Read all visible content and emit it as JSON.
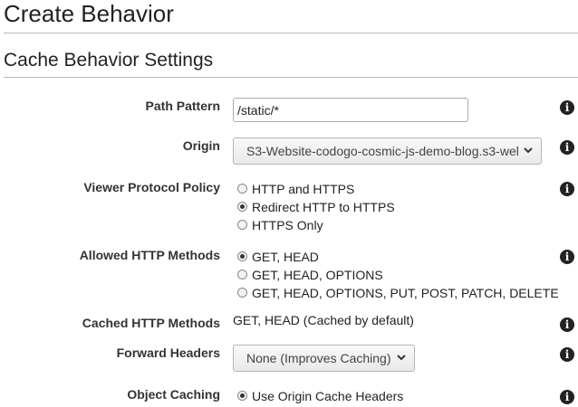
{
  "page_title": "Create Behavior",
  "section_title": "Cache Behavior Settings",
  "fields": {
    "path_pattern": {
      "label": "Path Pattern",
      "value": "/static/*"
    },
    "origin": {
      "label": "Origin",
      "value": "S3-Website-codogo-cosmic-js-demo-blog.s3-wel"
    },
    "viewer_protocol_policy": {
      "label": "Viewer Protocol Policy",
      "options": [
        "HTTP and HTTPS",
        "Redirect HTTP to HTTPS",
        "HTTPS Only"
      ],
      "selected": "Redirect HTTP to HTTPS"
    },
    "allowed_http_methods": {
      "label": "Allowed HTTP Methods",
      "options": [
        "GET, HEAD",
        "GET, HEAD, OPTIONS",
        "GET, HEAD, OPTIONS, PUT, POST, PATCH, DELETE"
      ],
      "selected": "GET, HEAD"
    },
    "cached_http_methods": {
      "label": "Cached HTTP Methods",
      "value": "GET, HEAD (Cached by default)"
    },
    "forward_headers": {
      "label": "Forward Headers",
      "value": "None (Improves Caching)"
    },
    "object_caching": {
      "label": "Object Caching",
      "options": [
        "Use Origin Cache Headers"
      ],
      "selected": "Use Origin Cache Headers"
    }
  },
  "icons": {
    "info": "info-icon",
    "dropdown": "chevron-down-icon"
  },
  "info_glyph": "i"
}
